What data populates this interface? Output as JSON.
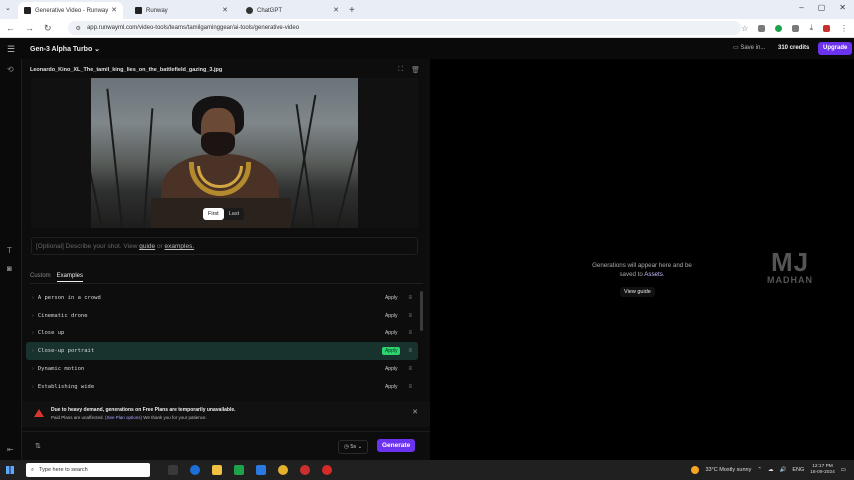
{
  "browser": {
    "tabs": [
      {
        "label": "Generative Video - Runway",
        "active": true
      },
      {
        "label": "Runway",
        "active": false
      },
      {
        "label": "ChatGPT",
        "active": false
      }
    ],
    "url": "app.runwayml.com/video-tools/teams/tamilgaminggear/ai-tools/generative-video"
  },
  "app": {
    "title": "Gen-3 Alpha Turbo",
    "save_in": "Save in...",
    "credits": "310 credits",
    "upgrade": "Upgrade"
  },
  "panel": {
    "filename": "Leonardo_Kino_XL_The_tamil_king_lies_on_the_battlefield_gazing_3.jpg",
    "toggle": {
      "first": "First",
      "last": "Last"
    },
    "prompt": {
      "placeholder": "[Optional] Describe your shot. View",
      "guide": "guide",
      "or": "or",
      "examples": "examples."
    },
    "subtabs": {
      "custom": "Custom",
      "examples": "Examples"
    },
    "presets": [
      {
        "name": "A person in a crowd",
        "apply": "Apply"
      },
      {
        "name": "Cinematic drone",
        "apply": "Apply"
      },
      {
        "name": "Close up",
        "apply": "Apply"
      },
      {
        "name": "Close-up portrait",
        "apply": "Apply"
      },
      {
        "name": "Dynamic motion",
        "apply": "Apply"
      },
      {
        "name": "Establishing wide",
        "apply": "Apply"
      }
    ],
    "notice": {
      "line1": "Due to heavy demand, generations on Free Plans are temporarily unavailable.",
      "line2a": "Paid Plans are unaffected.",
      "line2_link": "(See Plan options)",
      "line2b": "We thank you for your patience."
    },
    "duration": "5s",
    "generate": "Generate"
  },
  "right": {
    "msg1": "Generations will appear here and be",
    "msg2": "saved to",
    "assets": "Assets",
    "view_guide": "View guide",
    "watermark_big": "MJ",
    "watermark_small": "MADHAN"
  },
  "taskbar": {
    "search_placeholder": "Type here to search",
    "weather": "33°C  Mostly sunny",
    "lang": "ENG",
    "time": "12:17 PM",
    "date": "18-09-2024"
  }
}
